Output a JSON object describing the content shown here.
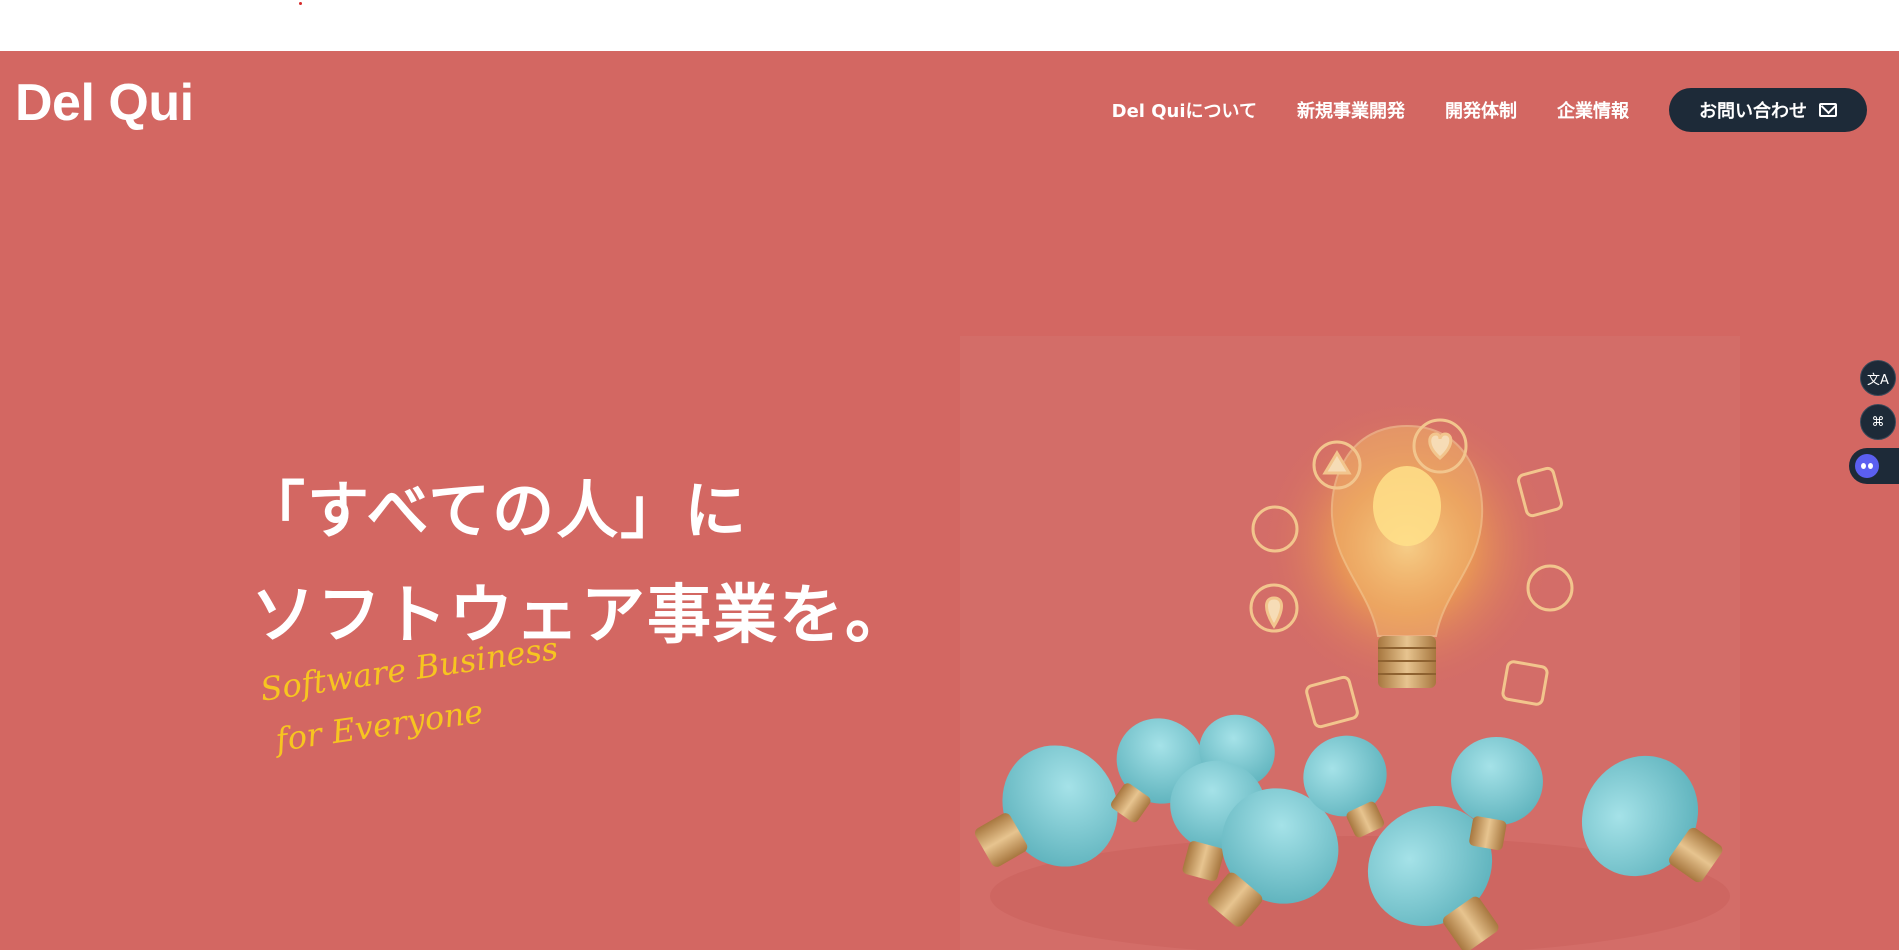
{
  "header": {
    "logo": "Del Qui",
    "nav": [
      {
        "label": "Del Quiについて"
      },
      {
        "label": "新規事業開発"
      },
      {
        "label": "開発体制"
      },
      {
        "label": "企業情報"
      }
    ],
    "contact_label": "お問い合わせ"
  },
  "hero": {
    "headline_line1": "「すべての人」に",
    "headline_line2": "ソフトウェア事業を。",
    "tagline_line1": "Software Business",
    "tagline_line2": "for Everyone"
  },
  "side_tools": {
    "translate_glyph": "文A",
    "apps_glyph": "⌘"
  },
  "colors": {
    "hero_bg": "#d36762",
    "button_dark": "#1d2a38",
    "tagline_yellow": "#f7c520",
    "bulb_teal": "#7ecbd3",
    "bulb_base_gold": "#c99a5b"
  },
  "icons": [
    "mail-icon",
    "translate-icon",
    "apps-icon",
    "chatbot-icon",
    "lightbulb-illustration"
  ]
}
